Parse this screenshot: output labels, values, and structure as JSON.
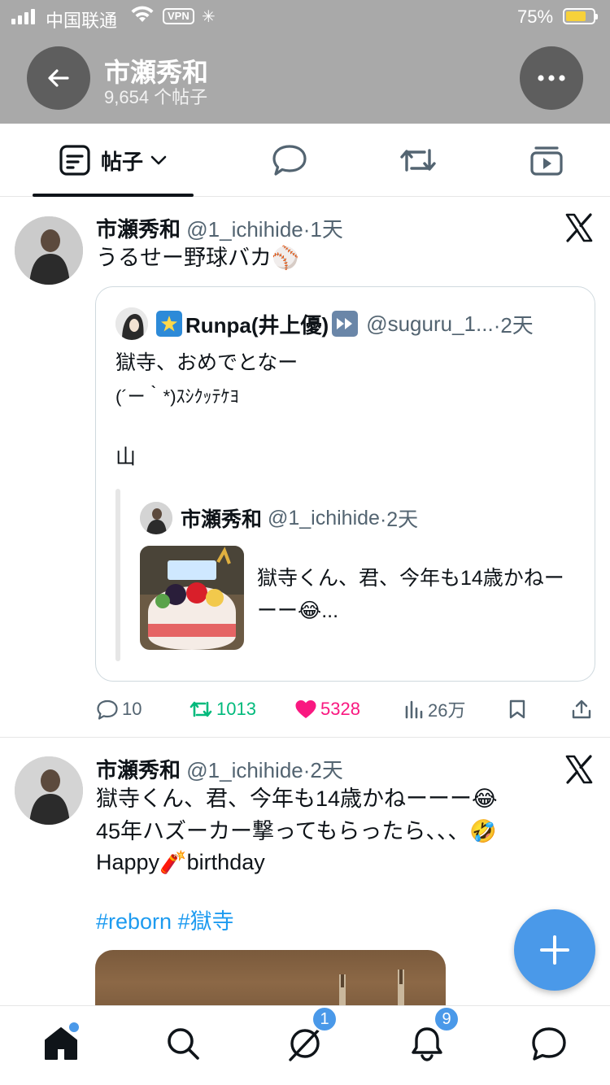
{
  "status_bar": {
    "carrier": "中国联通",
    "vpn": "VPN",
    "battery_pct": "75%",
    "battery_level": 0.75
  },
  "header": {
    "title": "市瀬秀和",
    "subtitle": "9,654 个帖子",
    "back_icon": "arrow-left-icon",
    "more_icon": "more-horizontal-icon"
  },
  "tabs": {
    "posts_label": "帖子",
    "items": [
      "posts-tab",
      "replies-tab",
      "reposts-tab",
      "media-tab"
    ]
  },
  "tweet1": {
    "name": "市瀬秀和",
    "handle": "@1_ichihide",
    "time": "·1天",
    "text": "うるせー野球バカ⚾",
    "quote": {
      "name": "Runpa(井上優)",
      "handle": "@suguru_1...",
      "time": "·2天",
      "line1": "獄寺、おめでとなー",
      "line2": "(´ー｀*)ｽｼｸｯﾃｹﾖ",
      "line3": "山",
      "nested": {
        "name": "市瀬秀和",
        "handle": "@1_ichihide",
        "time": "·2天",
        "text": "獄寺くん、君、今年も14歳かねーーー😂..."
      }
    },
    "actions": {
      "replies": "10",
      "reposts": "1013",
      "likes": "5328",
      "views": "26万"
    },
    "colors": {
      "repost": "#00ba7c",
      "like": "#f91880"
    }
  },
  "tweet2": {
    "name": "市瀬秀和",
    "handle": "@1_ichihide",
    "time": "·2天",
    "line1": "獄寺くん、君、今年も14歳かねーーー😂",
    "line2": "45年ハズーカー撃ってもらったら、、、🤣",
    "line3": "Happy🧨birthday",
    "hashtags": "#reborn #獄寺"
  },
  "bottom_nav": {
    "messages_badge": "1",
    "notifications_badge": "9"
  },
  "accent": "#4a99e9"
}
